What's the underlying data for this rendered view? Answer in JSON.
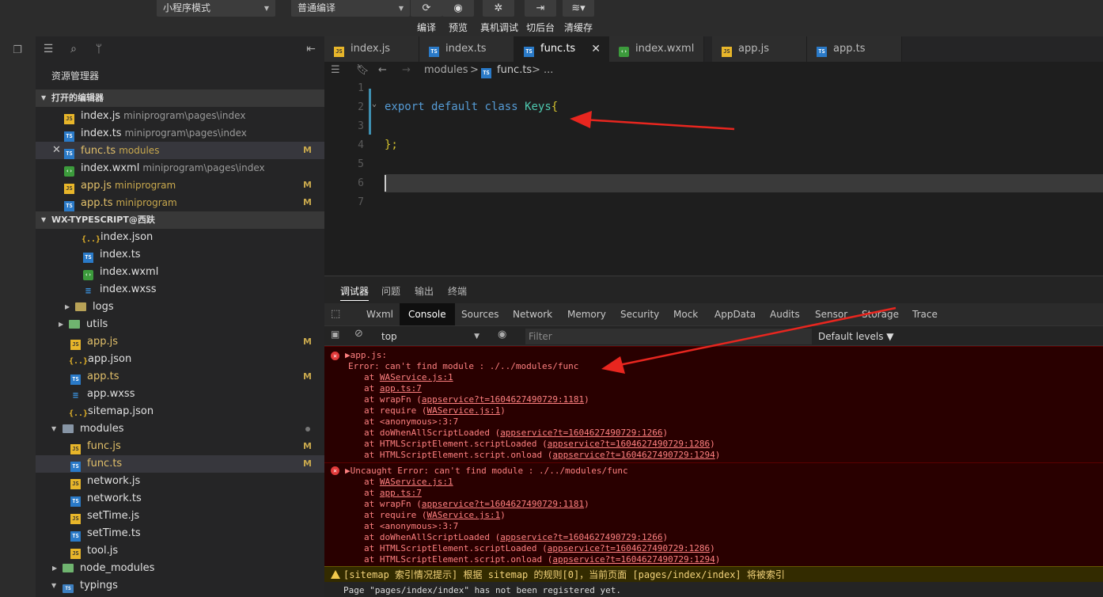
{
  "toolbar": {
    "mode_select": "小程序模式",
    "compile_select": "普通编译",
    "buttons": [
      "编译",
      "预览",
      "真机调试",
      "切后台",
      "清缓存"
    ]
  },
  "sidebar": {
    "title": "资源管理器",
    "open_editors_header": "打开的编辑器",
    "project_header": "WX-TYPESCRIPT@西趺",
    "open_editors": [
      {
        "name": "index.js",
        "path": "miniprogram\\pages\\index",
        "badge": ""
      },
      {
        "name": "index.ts",
        "path": "miniprogram\\pages\\index",
        "badge": ""
      },
      {
        "name": "func.ts",
        "path": "modules",
        "badge": "M"
      },
      {
        "name": "index.wxml",
        "path": "miniprogram\\pages\\index",
        "badge": ""
      },
      {
        "name": "app.js",
        "path": "miniprogram",
        "badge": "M"
      },
      {
        "name": "app.ts",
        "path": "miniprogram",
        "badge": "M"
      }
    ],
    "tree": [
      {
        "name": "index.json",
        "badge": ""
      },
      {
        "name": "index.ts",
        "badge": ""
      },
      {
        "name": "index.wxml",
        "badge": ""
      },
      {
        "name": "index.wxss",
        "badge": ""
      },
      {
        "name": "logs",
        "badge": ""
      },
      {
        "name": "utils",
        "badge": ""
      },
      {
        "name": "app.js",
        "badge": "M"
      },
      {
        "name": "app.json",
        "badge": ""
      },
      {
        "name": "app.ts",
        "badge": "M"
      },
      {
        "name": "app.wxss",
        "badge": ""
      },
      {
        "name": "sitemap.json",
        "badge": ""
      },
      {
        "name": "modules",
        "badge": ""
      },
      {
        "name": "func.js",
        "badge": "M"
      },
      {
        "name": "func.ts",
        "badge": "M"
      },
      {
        "name": "network.js",
        "badge": ""
      },
      {
        "name": "network.ts",
        "badge": ""
      },
      {
        "name": "setTime.js",
        "badge": ""
      },
      {
        "name": "setTime.ts",
        "badge": ""
      },
      {
        "name": "tool.js",
        "badge": ""
      },
      {
        "name": "node_modules",
        "badge": ""
      },
      {
        "name": "typings",
        "badge": ""
      }
    ]
  },
  "tabs": [
    {
      "label": "index.js"
    },
    {
      "label": "index.ts"
    },
    {
      "label": "func.ts",
      "close": "✕"
    },
    {
      "label": "index.wxml"
    },
    {
      "label": "app.js"
    },
    {
      "label": "app.ts"
    }
  ],
  "breadcrumb": {
    "folder": "modules",
    "sep": ">",
    "file": "func.ts",
    "tail": "> ..."
  },
  "code": {
    "line_numbers": [
      "1",
      "2",
      "3",
      "4",
      "5",
      "6",
      "7"
    ],
    "kw_export": "export",
    "kw_default": "default",
    "kw_class": "class",
    "class_name": "Keys",
    "open_brace": "{",
    "close_line": "};"
  },
  "panel": {
    "tabs": [
      "调试器",
      "问题",
      "输出",
      "终端"
    ],
    "devtools_tabs": [
      "Wxml",
      "Console",
      "Sources",
      "Network",
      "Memory",
      "Security",
      "Mock",
      "AppData",
      "Audits",
      "Sensor",
      "Storage",
      "Trace"
    ],
    "context": "top",
    "filter_placeholder": "Filter",
    "levels": "Default levels ▼",
    "error1": {
      "head": "▶app.js:",
      "msg": "Error: can't find module : ./../modules/func",
      "stack": [
        {
          "pre": "at ",
          "link": "WAService.js:1",
          "post": ""
        },
        {
          "pre": "at ",
          "link": "app.ts:7",
          "post": ""
        },
        {
          "pre": "at wrapFn (",
          "link": "appservice?t=1604627490729:1181",
          "post": ")"
        },
        {
          "pre": "at require (",
          "link": "WAService.js:1",
          "post": ")"
        },
        {
          "pre": "at <anonymous>:3:7",
          "link": "",
          "post": ""
        },
        {
          "pre": "at doWhenAllScriptLoaded (",
          "link": "appservice?t=1604627490729:1266",
          "post": ")"
        },
        {
          "pre": "at HTMLScriptElement.scriptLoaded (",
          "link": "appservice?t=1604627490729:1286",
          "post": ")"
        },
        {
          "pre": "at HTMLScriptElement.script.onload (",
          "link": "appservice?t=1604627490729:1294",
          "post": ")"
        }
      ]
    },
    "error2": {
      "head": "▶Uncaught Error: can't find module : ./../modules/func",
      "stack": [
        {
          "pre": "at ",
          "link": "WAService.js:1",
          "post": ""
        },
        {
          "pre": "at ",
          "link": "app.ts:7",
          "post": ""
        },
        {
          "pre": "at wrapFn (",
          "link": "appservice?t=1604627490729:1181",
          "post": ")"
        },
        {
          "pre": "at require (",
          "link": "WAService.js:1",
          "post": ")"
        },
        {
          "pre": "at <anonymous>:3:7",
          "link": "",
          "post": ""
        },
        {
          "pre": "at doWhenAllScriptLoaded (",
          "link": "appservice?t=1604627490729:1266",
          "post": ")"
        },
        {
          "pre": "at HTMLScriptElement.scriptLoaded (",
          "link": "appservice?t=1604627490729:1286",
          "post": ")"
        },
        {
          "pre": "at HTMLScriptElement.script.onload (",
          "link": "appservice?t=1604627490729:1294",
          "post": ")"
        }
      ]
    },
    "warning": "[sitemap 索引情况提示] 根据 sitemap 的规则[0]，当前页面 [pages/index/index] 将被索引",
    "info": "Page \"pages/index/index\" has not been registered yet."
  },
  "colors": {
    "accent": "#3e8fb0",
    "error_bg": "#290000",
    "annotation_arrow": "#e8261f"
  }
}
